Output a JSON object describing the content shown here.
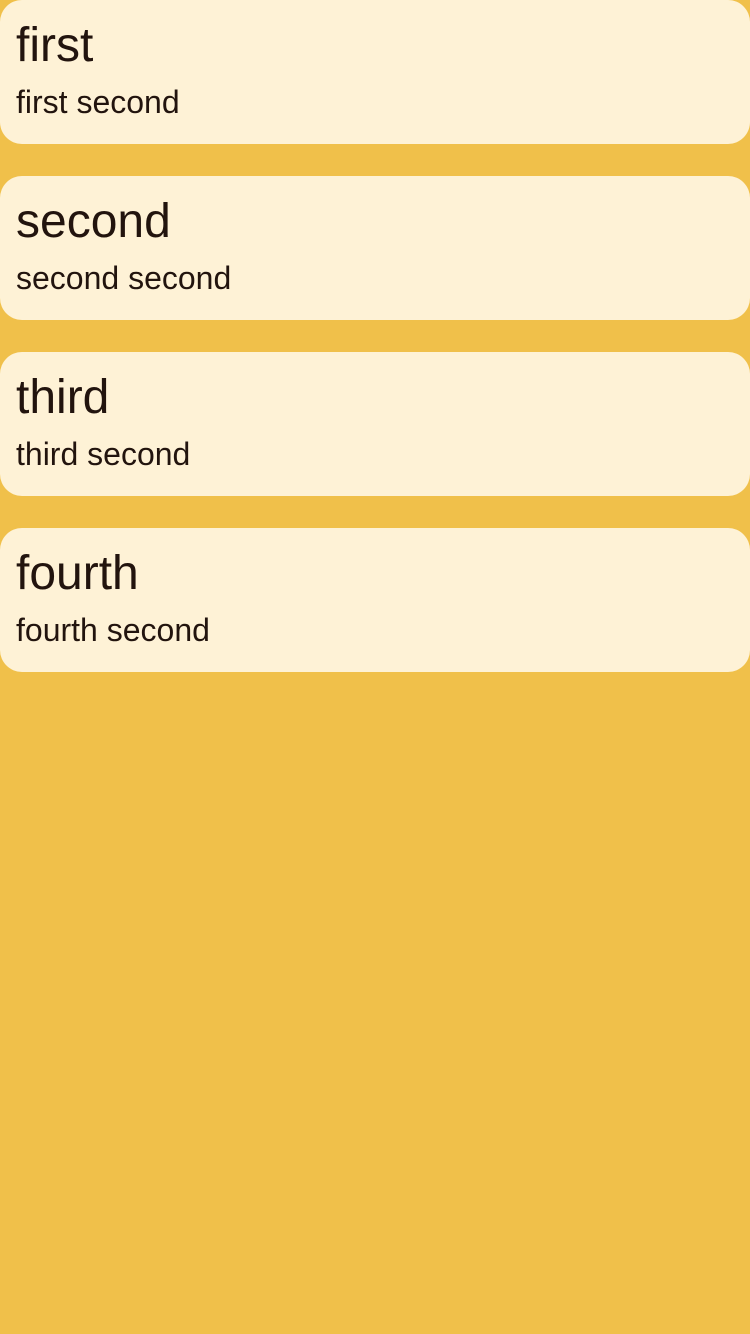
{
  "theme": {
    "background": "#F0C04A",
    "card_background": "#FEF2D6",
    "text_color": "#22140E"
  },
  "items": [
    {
      "title": "first",
      "subtitle": "first second"
    },
    {
      "title": "second",
      "subtitle": "second second"
    },
    {
      "title": "third",
      "subtitle": "third second"
    },
    {
      "title": "fourth",
      "subtitle": "fourth second"
    }
  ]
}
